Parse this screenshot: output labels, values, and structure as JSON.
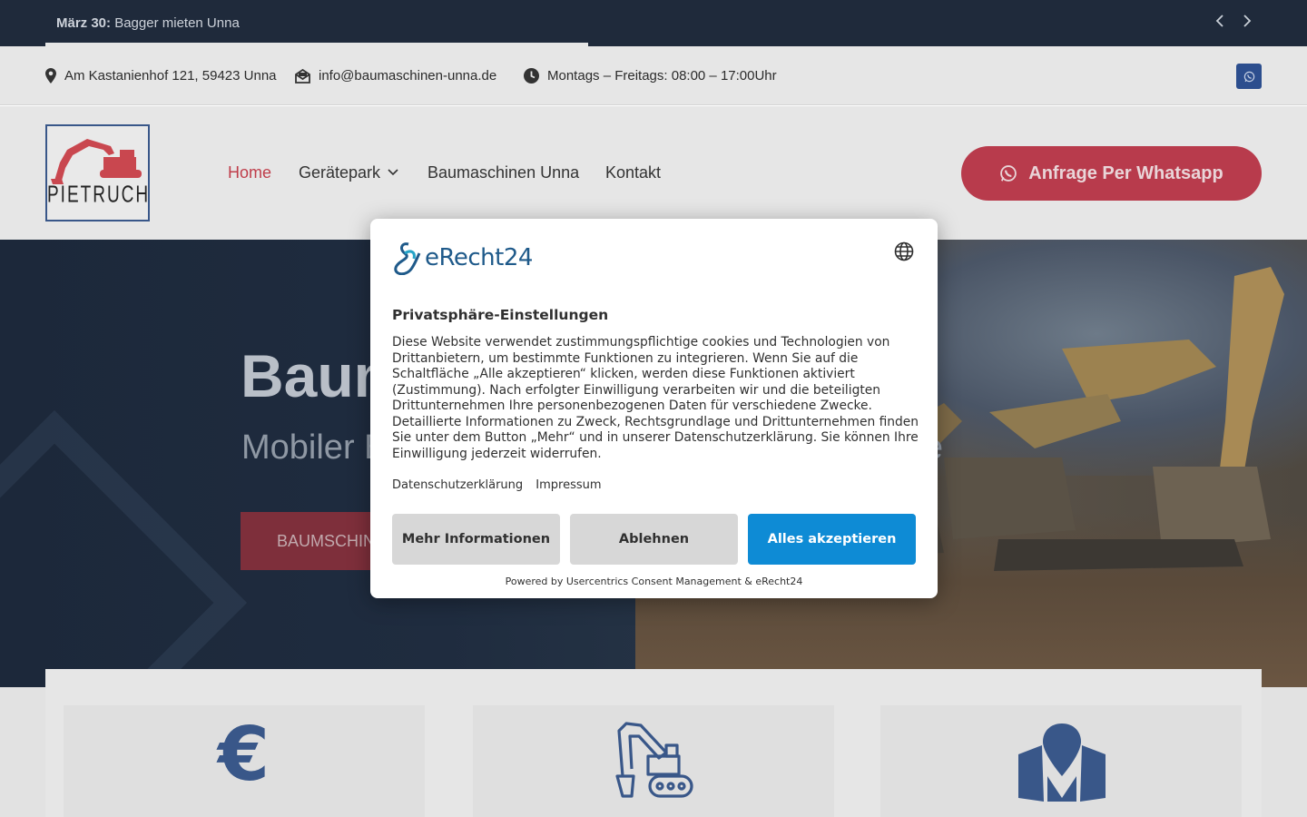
{
  "ticker": {
    "date": "März 30:",
    "headline": "Bagger mieten Unna",
    "prev_icon": "chevron-left-icon",
    "next_icon": "chevron-right-icon"
  },
  "infobar": {
    "address": "Am Kastanienhof 121, 59423 Unna",
    "email": "info@baumaschinen-unna.de",
    "hours": "Montags – Freitags: 08:00 – 17:00Uhr"
  },
  "header": {
    "logo_text": "PIETRUCHA",
    "nav": [
      {
        "label": "Home",
        "active": true
      },
      {
        "label": "Gerätepark",
        "has_dropdown": true
      },
      {
        "label": "Baumaschinen Unna"
      },
      {
        "label": "Kontakt"
      }
    ],
    "cta_label": "Anfrage Per Whatsapp"
  },
  "hero": {
    "title": "Baumaschinen Unna",
    "subtitle": "Mobiler Baumaschinen- und Reparaturservice",
    "button_label": "BAUMSCHINEN MIETEN"
  },
  "features": {
    "icons": [
      "euro-icon",
      "excavator-icon",
      "map-location-icon"
    ],
    "euro_glyph": "€"
  },
  "consent": {
    "brand": "eRecht24",
    "title": "Privatsphäre-Einstellungen",
    "body": "Diese Website verwendet zustimmungspflichtige cookies und Technologien von Drittanbietern, um bestimmte Funktionen zu integrieren. Wenn Sie auf die Schaltfläche „Alle akzeptieren“ klicken, werden diese Funktionen aktiviert (Zustimmung). Nach erfolgter Einwilligung verarbeiten wir und die beteiligten Drittunternehmen Ihre personenbezogenen Daten für verschiedene Zwecke. Detaillierte Informationen zu Zweck, Rechtsgrundlage und Drittunternehmen finden Sie unter dem Button „Mehr“ und in unserer Datenschutzerklärung. Sie können Ihre Einwilligung jederzeit widerrufen.",
    "link_privacy": "Datenschutzerklärung",
    "link_imprint": "Impressum",
    "btn_more": "Mehr Informationen",
    "btn_decline": "Ablehnen",
    "btn_accept": "Alles akzeptieren",
    "powered_by": "Powered by Usercentrics Consent Management & eRecht24"
  },
  "colors": {
    "brand_red": "#b83b4c",
    "brand_blue": "#395789",
    "accept_blue": "#0e8bd5",
    "ticker_bg": "#1f2a3b"
  }
}
